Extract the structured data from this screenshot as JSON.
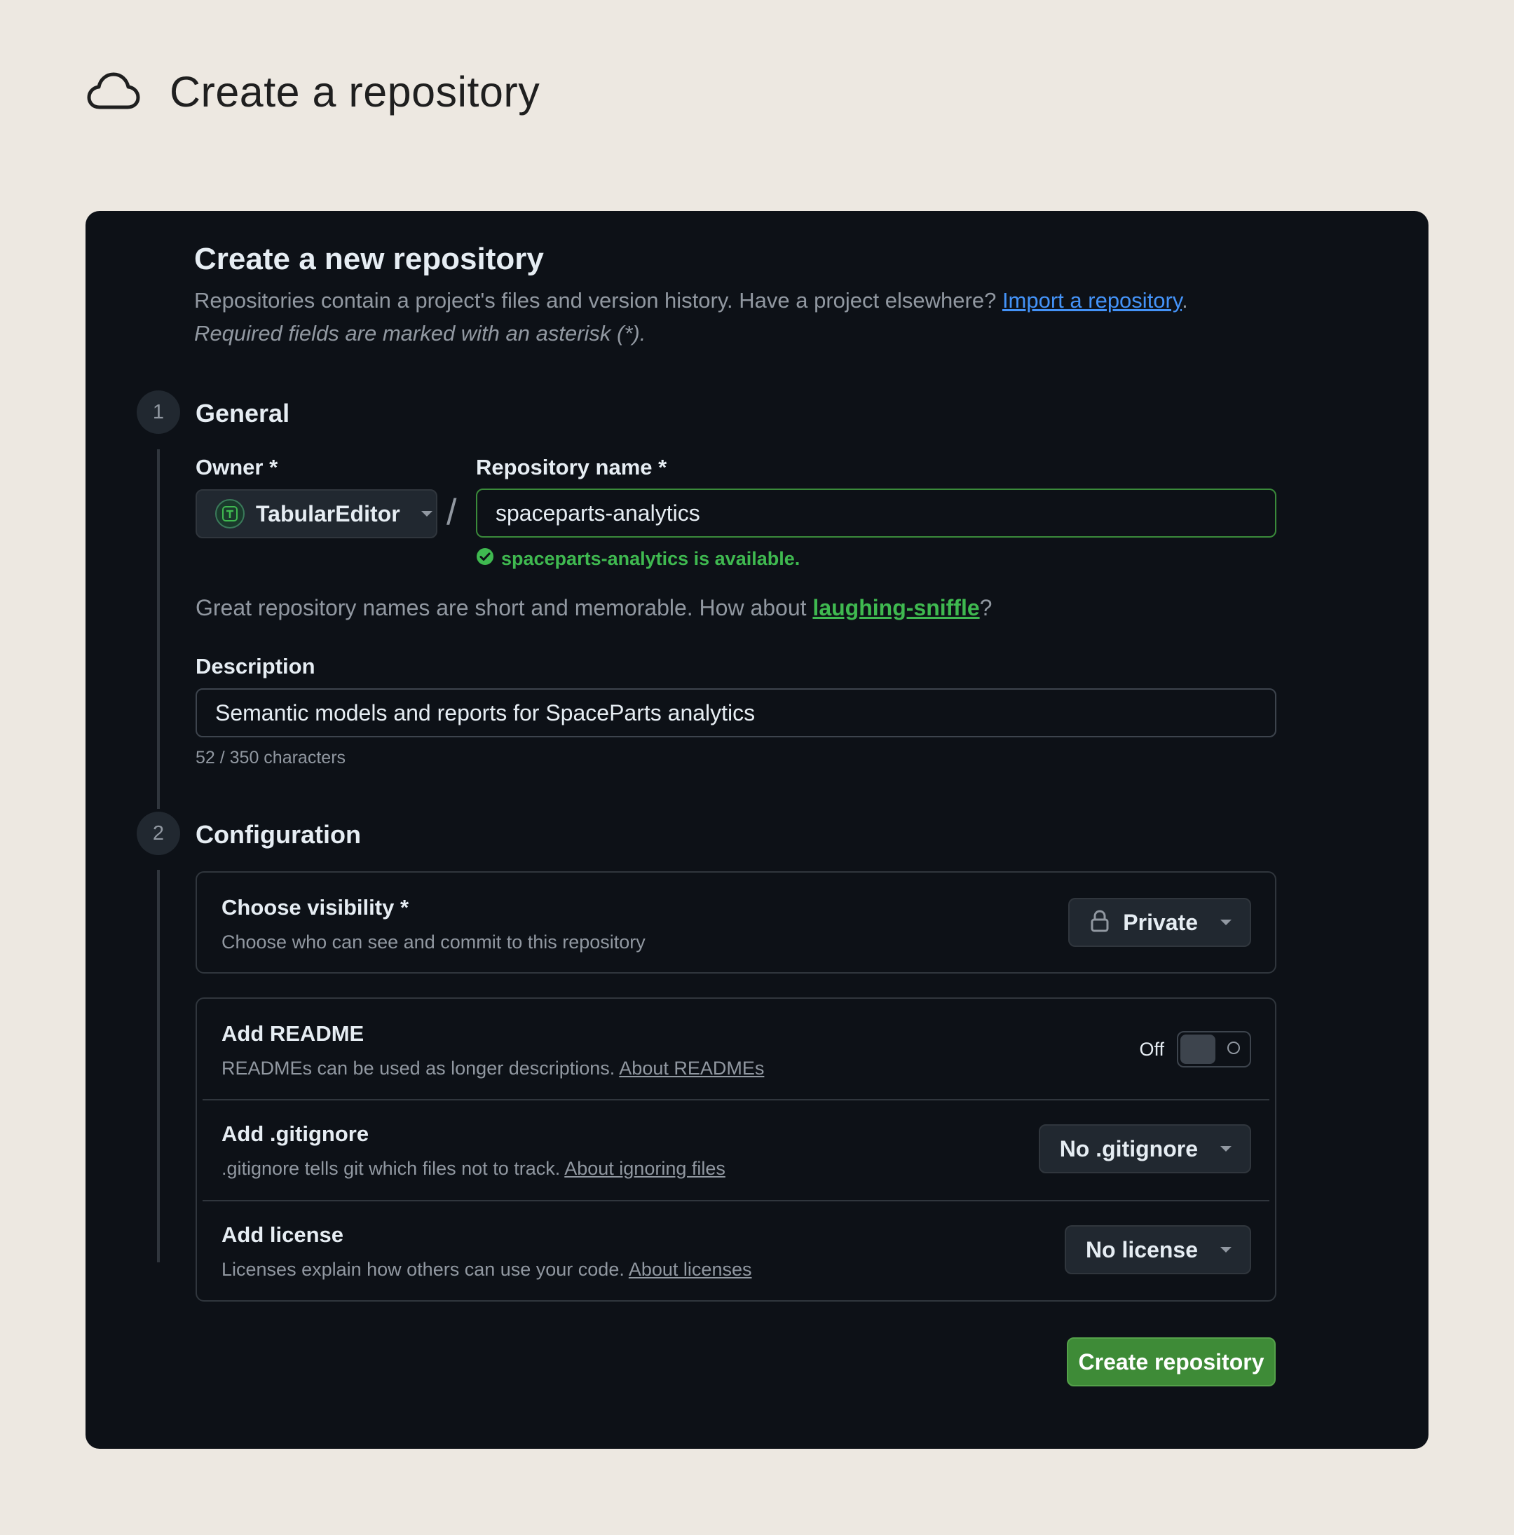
{
  "page": {
    "title": "Create a repository",
    "icon": "cloud-icon"
  },
  "form": {
    "heading": "Create a new repository",
    "subtitle": "Repositories contain a project's files and version history. Have a project elsewhere?",
    "import_link": "Import a repository",
    "subtitle_end": ".",
    "required_note": "Required fields are marked with an asterisk (*).",
    "steps": [
      {
        "number": "1",
        "title": "General"
      },
      {
        "number": "2",
        "title": "Configuration"
      }
    ]
  },
  "general": {
    "owner_label": "Owner *",
    "owner_value": "TabularEditor",
    "owner_avatar_letter": "T",
    "repo_label": "Repository name *",
    "repo_value": "spaceparts-analytics",
    "availability": "spaceparts-analytics is available.",
    "suggestion_prefix": "Great repository names are short and memorable. How about",
    "suggestion_name": "laughing-sniffle",
    "suggestion_suffix": "?",
    "description_label": "Description",
    "description_value": "Semantic models and reports for SpaceParts analytics",
    "char_count": "52 / 350 characters"
  },
  "configuration": {
    "visibility": {
      "title": "Choose visibility *",
      "desc": "Choose who can see and commit to this repository",
      "value": "Private",
      "icon": "lock-icon"
    },
    "readme": {
      "title": "Add README",
      "desc": "READMEs can be used as longer descriptions.",
      "link": "About READMEs",
      "toggle_state": "Off"
    },
    "gitignore": {
      "title": "Add .gitignore",
      "desc": ".gitignore tells git which files not to track.",
      "link": "About ignoring files",
      "value": "No .gitignore"
    },
    "license": {
      "title": "Add license",
      "desc": "Licenses explain how others can use your code.",
      "link": "About licenses",
      "value": "No license"
    }
  },
  "actions": {
    "create_label": "Create repository"
  },
  "colors": {
    "page_bg": "#ede8e1",
    "panel_bg": "#0d1117",
    "accent_green": "#3fb950",
    "button_green": "#3e8b37",
    "link_blue": "#4493f8"
  }
}
